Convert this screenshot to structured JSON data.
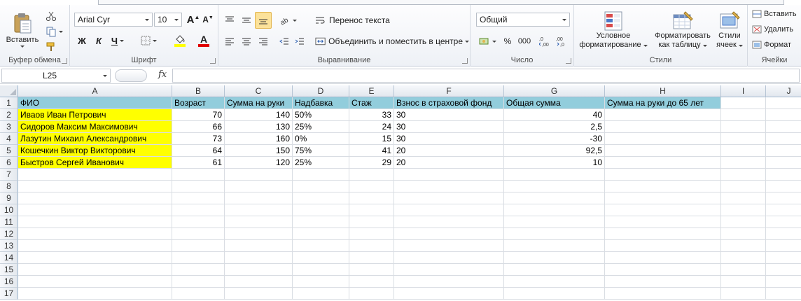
{
  "ribbon": {
    "clipboard": {
      "paste_label": "Вставить",
      "group_label": "Буфер обмена"
    },
    "font": {
      "font_name": "Arial Cyr",
      "font_size": "10",
      "bold": "Ж",
      "italic": "К",
      "underline": "Ч",
      "font_color": "A",
      "group_label": "Шрифт"
    },
    "alignment": {
      "wrap_text": "Перенос текста",
      "merge_center": "Объединить и поместить в центре",
      "group_label": "Выравнивание"
    },
    "number": {
      "format": "Общий",
      "percent": "%",
      "thousands": "000",
      "inc_decimal": ",0→,00",
      "dec_decimal": ",00→,0",
      "group_label": "Число"
    },
    "styles": {
      "conditional_line1": "Условное",
      "conditional_line2": "форматирование",
      "format_table_line1": "Форматировать",
      "format_table_line2": "как таблицу",
      "cell_styles_line1": "Стили",
      "cell_styles_line2": "ячеек",
      "group_label": "Стили"
    },
    "cells": {
      "insert": "Вставить",
      "delete": "Удалить",
      "format": "Формат",
      "group_label": "Ячейки"
    },
    "colors": {
      "accent_yellow": "#ffff00",
      "header_fill": "#92cddc",
      "font_color_red": "#e00000",
      "fill_yellow": "#ffff00"
    }
  },
  "formula_bar": {
    "name_box": "L25",
    "fx": "fx",
    "formula": ""
  },
  "sheet": {
    "columns": [
      "A",
      "B",
      "C",
      "D",
      "E",
      "F",
      "G",
      "H",
      "I",
      "J"
    ],
    "rows": [
      "1",
      "2",
      "3",
      "4",
      "5",
      "6",
      "7",
      "8",
      "9",
      "10",
      "11",
      "12",
      "13",
      "14",
      "15",
      "16",
      "17"
    ],
    "header_row": [
      "ФИО",
      "Возраст",
      "Сумма на руки",
      "Надбавка",
      "Стаж",
      "Взнос в страховой фонд",
      "Общая сумма",
      "Сумма на руки до 65 лет"
    ],
    "data": [
      [
        "Иваов Иван Петрович",
        "70",
        "140",
        "50%",
        "33",
        "30",
        "40",
        ""
      ],
      [
        "Сидоров Максим Максимович",
        "66",
        "130",
        "25%",
        "24",
        "30",
        "2,5",
        ""
      ],
      [
        "Лазутин Михаил Александрович",
        "73",
        "160",
        "0%",
        "15",
        "30",
        "-30",
        ""
      ],
      [
        "Кошечкин Виктор Викторович",
        "64",
        "150",
        "75%",
        "41",
        "20",
        "92,5",
        ""
      ],
      [
        "Быстров Сергей Иванович",
        "61",
        "120",
        "25%",
        "29",
        "20",
        "10",
        ""
      ]
    ]
  }
}
